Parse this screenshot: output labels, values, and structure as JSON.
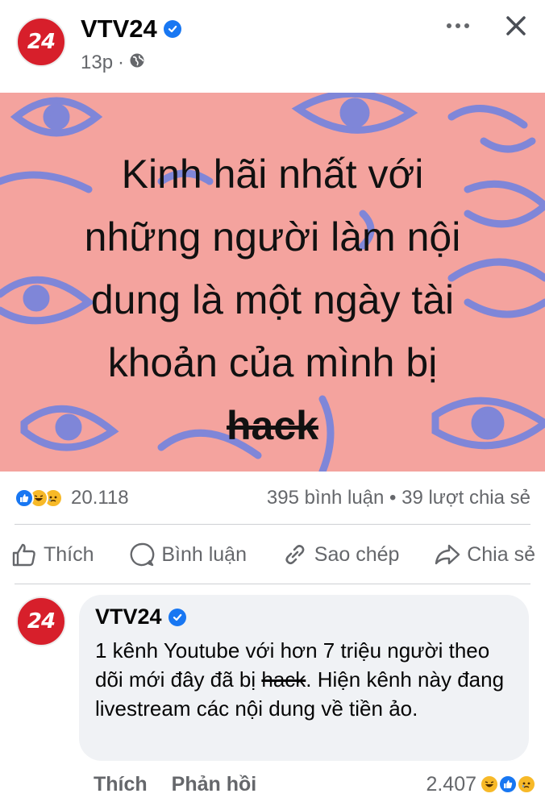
{
  "post": {
    "page_name": "VTV24",
    "avatar_text": "24",
    "time": "13p",
    "separator": "·",
    "image_headline_lines": [
      "Kinh hãi nhất với",
      "những người làm nội",
      "dung  là một ngày tài",
      "khoản của mình bị"
    ],
    "image_headline_strike": "hack"
  },
  "stats": {
    "reaction_count": "20.118",
    "comments_shares": "395 bình luận • 39 lượt chia sẻ",
    "reactions": [
      "like",
      "haha",
      "sad"
    ]
  },
  "actions": {
    "like": "Thích",
    "comment": "Bình luận",
    "copy": "Sao chép",
    "share": "Chia sẻ"
  },
  "comment": {
    "author": "VTV24",
    "avatar_text": "24",
    "text_before": "1 kênh Youtube với hơn 7 triệu người theo dõi mới đây đã bị ",
    "text_strike": "hack",
    "text_after": ". Hiện kênh này đang livestream các nội dung về tiền ảo.",
    "like_label": "Thích",
    "reply_label": "Phản hồi",
    "reaction_count": "2.407",
    "reactions": [
      "haha",
      "like",
      "sad"
    ]
  },
  "colors": {
    "accent": "#1877f2",
    "brand_red": "#d71f2b",
    "image_bg": "#f4a39e",
    "image_pattern": "#7f86d8"
  }
}
